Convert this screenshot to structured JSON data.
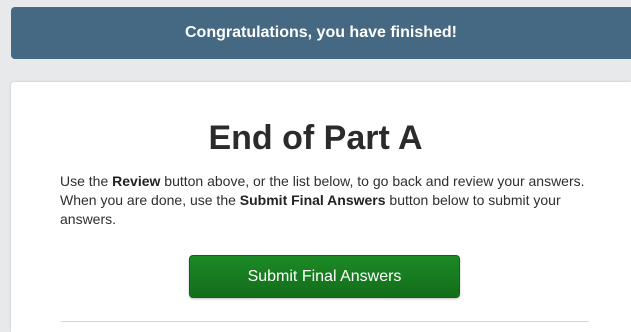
{
  "banner": {
    "text": "Congratulations, you have finished!"
  },
  "main": {
    "title": "End of Part A",
    "instructions": {
      "p1_prefix": "Use the ",
      "p1_bold1": "Review",
      "p1_middle": " button above, or the list below, to go back and review your answers. When you are done, use the ",
      "p1_bold2": "Submit Final Answers",
      "p1_suffix": " button below to submit your answers."
    },
    "submit_label": "Submit Final Answers"
  },
  "colors": {
    "banner_bg": "#466983",
    "submit_bg": "#1c8a25",
    "page_bg": "#e8e9ea"
  }
}
